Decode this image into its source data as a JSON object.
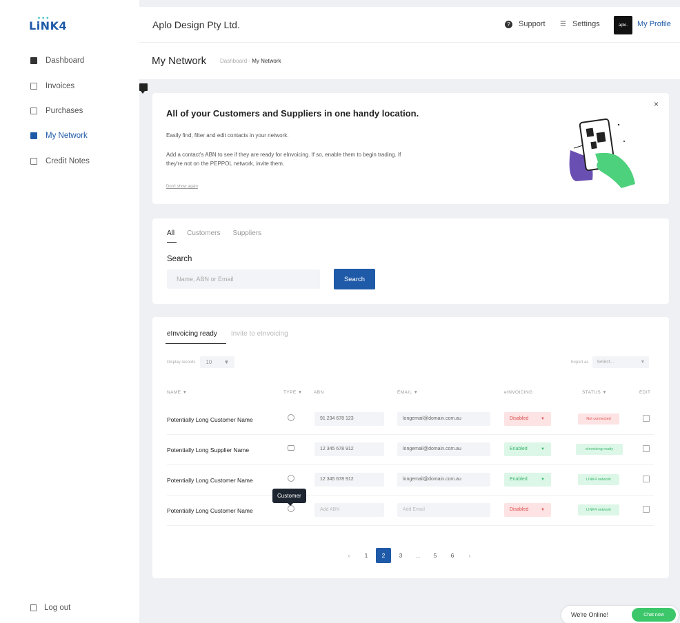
{
  "app": {
    "logo": "LiNK4"
  },
  "sidebar": {
    "items": [
      {
        "label": "Dashboard",
        "active": false
      },
      {
        "label": "Invoices",
        "active": false
      },
      {
        "label": "Purchases",
        "active": false
      },
      {
        "label": "My Network",
        "active": true
      },
      {
        "label": "Credit Notes",
        "active": false
      }
    ],
    "logout": "Log out"
  },
  "header": {
    "company": "Aplo Design Pty Ltd.",
    "support": "Support",
    "settings": "Settings",
    "avatar_text": "aplo.",
    "profile": "My Profile"
  },
  "page": {
    "title": "My Network",
    "breadcrumb_parent": "Dashboard",
    "breadcrumb_sep": " - ",
    "breadcrumb_current": "My Network"
  },
  "banner": {
    "heading": "All of your Customers and Suppliers in one handy location.",
    "p1": "Easily find, filter and edit contacts in your network.",
    "p2": "Add a contact's ABN to see if they are ready for eInvoicing. If so, enable them to begin trading. If they're not on the PEPPOL network, invite them.",
    "dont_show": "Don't show again",
    "close": "×"
  },
  "filter": {
    "tabs": [
      "All",
      "Customers",
      "Suppliers"
    ],
    "search_label": "Search",
    "search_placeholder": "Name, ABN or Email",
    "search_button": "Search"
  },
  "table": {
    "tabs": [
      "eInvoicing ready",
      "Invite to eInvoicing"
    ],
    "display_label": "Display records",
    "display_value": "10",
    "export_label": "Export as",
    "export_value": "Select...",
    "columns": {
      "name": "NAME ▼",
      "type": "TYPE ▼",
      "abn": "ABN",
      "email": "EMAIL ▼",
      "einvoicing": "eINVOICING",
      "status": "STATUS ▼",
      "edit": "EDIT"
    },
    "rows": [
      {
        "name": "Potentially Long Customer Name",
        "type": "customer",
        "abn": "91 234 678 123",
        "email": "longemail@domain.com.au",
        "einvoicing": "Disabled",
        "status": "Not connected"
      },
      {
        "name": "Potentially Long Supplier Name",
        "type": "supplier",
        "abn": "12 345 678 912",
        "email": "longemail@domain.com.au",
        "einvoicing": "Enabled",
        "status": "eInvoicing ready"
      },
      {
        "name": "Potentially Long Customer Name",
        "type": "customer",
        "abn": "12 345 678 912",
        "email": "longemail@domain.com.au",
        "einvoicing": "Enabled",
        "status": "LINK4 network"
      },
      {
        "name": "Potentially Long Customer Name",
        "type": "customer",
        "abn": "Add ABN",
        "email": "Add Email",
        "einvoicing": "Disabled",
        "status": "LINK4 network"
      }
    ],
    "tooltip": "Customer",
    "pagination": [
      "‹",
      "1",
      "2",
      "3",
      "...",
      "5",
      "6",
      "›"
    ],
    "current_page": "2"
  },
  "chat": {
    "online": "We're Online!",
    "button": "Chat now"
  },
  "colors": {
    "primary": "#1e5aa8",
    "success": "#3bb56d",
    "danger": "#e04f4f",
    "chat": "#3cc76b"
  }
}
